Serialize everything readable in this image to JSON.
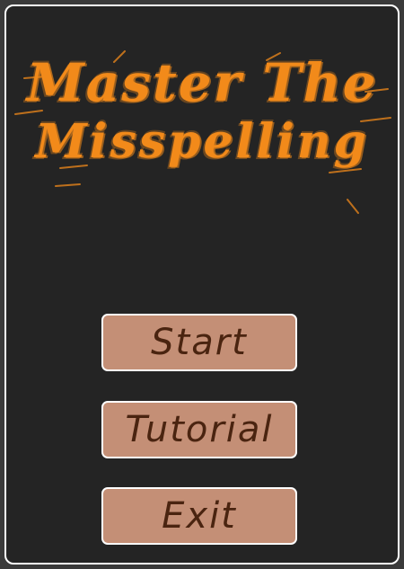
{
  "game": {
    "title_line1": "Master The",
    "title_line2": "Misspelling",
    "colors": {
      "background": "#242424",
      "border": "#ffffff",
      "title": "#f28a1a",
      "button_fill": "#c48f76",
      "button_text": "#4a2410"
    }
  },
  "menu": {
    "start_label": "Start",
    "tutorial_label": "Tutorial",
    "exit_label": "Exit"
  }
}
